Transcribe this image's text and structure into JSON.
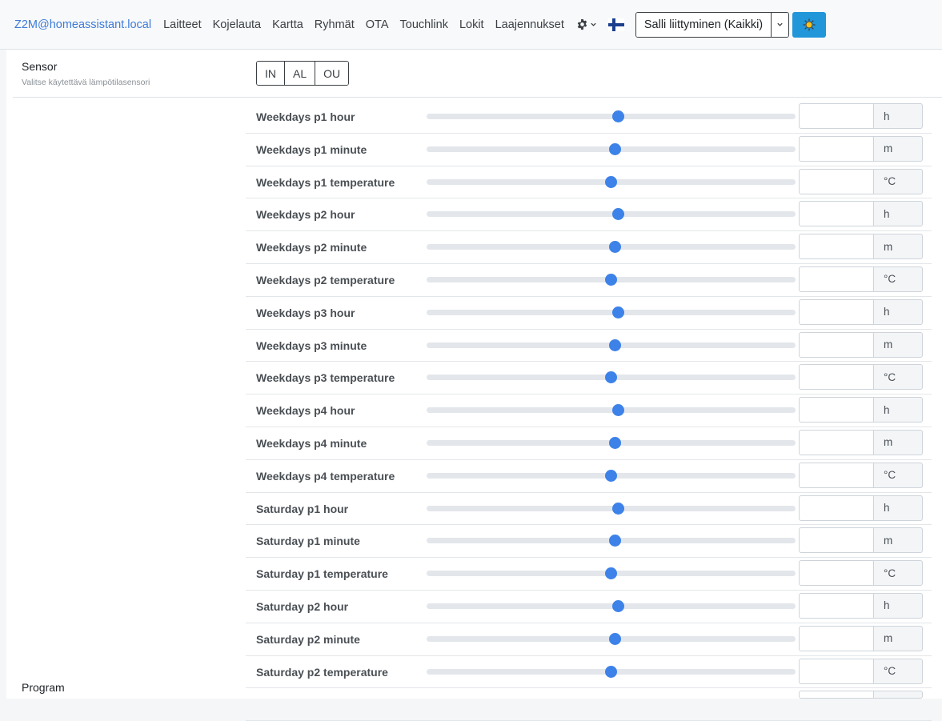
{
  "nav": {
    "brand": "Z2M@homeassistant.local",
    "links": [
      "Laitteet",
      "Kojelauta",
      "Kartta",
      "Ryhmät",
      "OTA",
      "Touchlink",
      "Lokit",
      "Laajennukset"
    ],
    "settings_icon": "gear-icon",
    "language_icon": "finnish-flag-icon",
    "permit_join_label": "Salli liittyminen (Kaikki)",
    "theme_icon": "sun-icon"
  },
  "sensor": {
    "title": "Sensor",
    "description": "Valitse käytettävä lämpötilasensori",
    "options": [
      "IN",
      "AL",
      "OU"
    ]
  },
  "program": {
    "title": "Program"
  },
  "colors": {
    "accent": "#3d82e8",
    "link": "#3d7bd9",
    "theme_button": "#2196d9"
  },
  "settings": [
    {
      "label": "Weekdays p1 hour",
      "unit": "h",
      "value_fraction": 0.52
    },
    {
      "label": "Weekdays p1 minute",
      "unit": "m",
      "value_fraction": 0.51
    },
    {
      "label": "Weekdays p1 temperature",
      "unit": "°C",
      "value_fraction": 0.5
    },
    {
      "label": "Weekdays p2 hour",
      "unit": "h",
      "value_fraction": 0.52
    },
    {
      "label": "Weekdays p2 minute",
      "unit": "m",
      "value_fraction": 0.51
    },
    {
      "label": "Weekdays p2 temperature",
      "unit": "°C",
      "value_fraction": 0.5
    },
    {
      "label": "Weekdays p3 hour",
      "unit": "h",
      "value_fraction": 0.52
    },
    {
      "label": "Weekdays p3 minute",
      "unit": "m",
      "value_fraction": 0.51
    },
    {
      "label": "Weekdays p3 temperature",
      "unit": "°C",
      "value_fraction": 0.5
    },
    {
      "label": "Weekdays p4 hour",
      "unit": "h",
      "value_fraction": 0.52
    },
    {
      "label": "Weekdays p4 minute",
      "unit": "m",
      "value_fraction": 0.51
    },
    {
      "label": "Weekdays p4 temperature",
      "unit": "°C",
      "value_fraction": 0.5
    },
    {
      "label": "Saturday p1 hour",
      "unit": "h",
      "value_fraction": 0.52
    },
    {
      "label": "Saturday p1 minute",
      "unit": "m",
      "value_fraction": 0.51
    },
    {
      "label": "Saturday p1 temperature",
      "unit": "°C",
      "value_fraction": 0.5
    },
    {
      "label": "Saturday p2 hour",
      "unit": "h",
      "value_fraction": 0.52
    },
    {
      "label": "Saturday p2 minute",
      "unit": "m",
      "value_fraction": 0.51
    },
    {
      "label": "Saturday p2 temperature",
      "unit": "°C",
      "value_fraction": 0.5
    }
  ]
}
